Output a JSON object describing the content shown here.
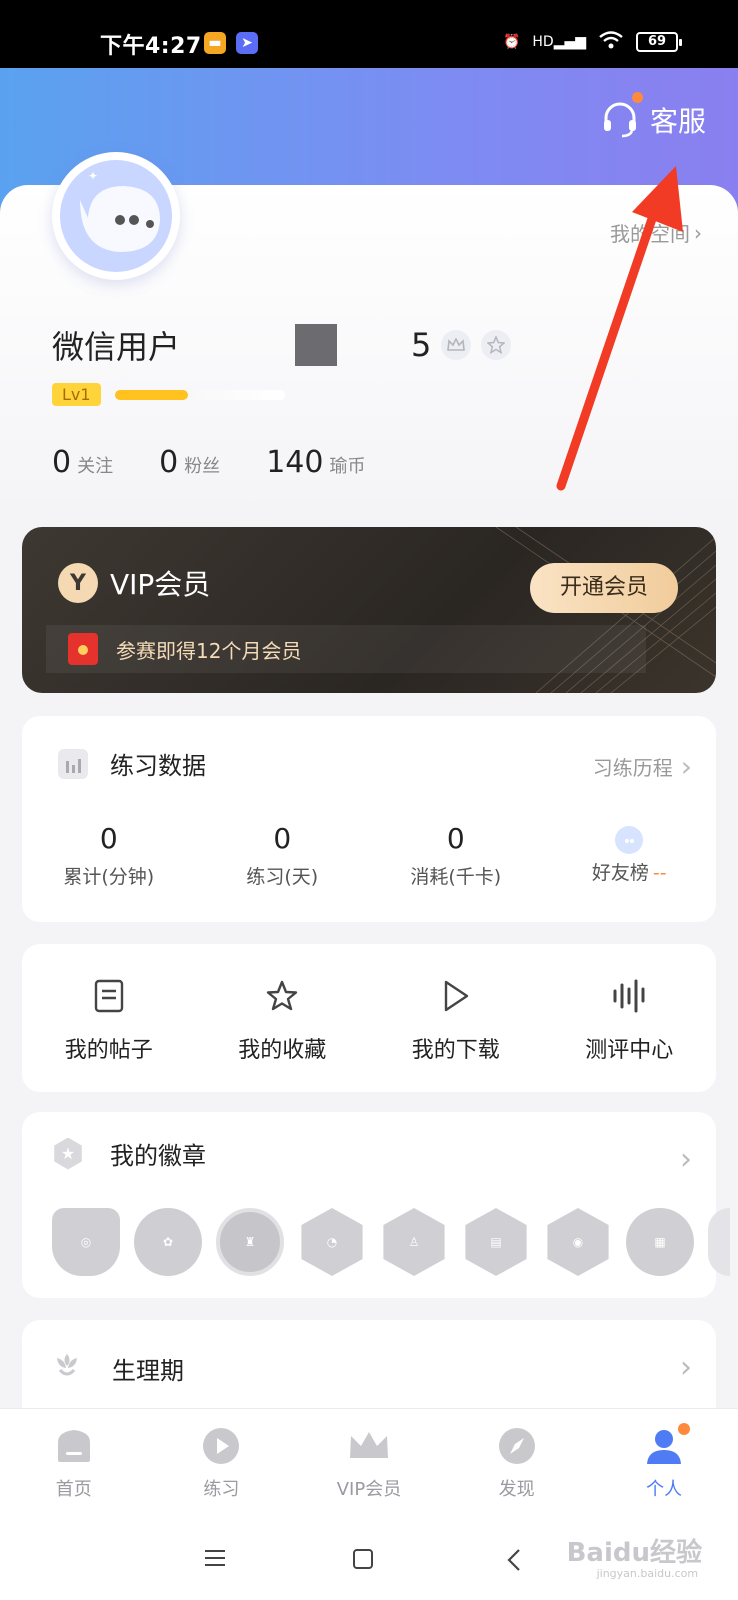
{
  "status_bar": {
    "time": "下午4:27",
    "network": "HD",
    "battery": "69"
  },
  "header": {
    "service_label": "客服"
  },
  "profile": {
    "my_space": "我的空间",
    "username_prefix": "微信用户",
    "username_suffix": "5",
    "level": "Lv1",
    "level_progress": 0.43,
    "stats": [
      {
        "value": "0",
        "label": "关注"
      },
      {
        "value": "0",
        "label": "粉丝"
      },
      {
        "value": "140",
        "label": "瑜币"
      }
    ]
  },
  "vip": {
    "title": "VIP会员",
    "button": "开通会员",
    "promo": "参赛即得12个月会员"
  },
  "practice": {
    "title": "练习数据",
    "link": "习练历程",
    "stats": [
      {
        "value": "0",
        "label": "累计(分钟)"
      },
      {
        "value": "0",
        "label": "练习(天)"
      },
      {
        "value": "0",
        "label": "消耗(千卡)"
      }
    ],
    "friends_label": "好友榜",
    "friends_value": "--"
  },
  "shortcuts": [
    {
      "label": "我的帖子",
      "icon": "document-icon"
    },
    {
      "label": "我的收藏",
      "icon": "star-icon"
    },
    {
      "label": "我的下载",
      "icon": "play-icon"
    },
    {
      "label": "测评中心",
      "icon": "waveform-icon"
    }
  ],
  "medals": {
    "title": "我的徽章"
  },
  "period": {
    "title": "生理期"
  },
  "tabbar": [
    {
      "label": "首页",
      "icon": "home-icon"
    },
    {
      "label": "练习",
      "icon": "play-circle-icon"
    },
    {
      "label": "VIP会员",
      "icon": "crown-icon"
    },
    {
      "label": "发现",
      "icon": "compass-icon"
    },
    {
      "label": "个人",
      "icon": "person-icon",
      "active": true
    }
  ],
  "watermark": {
    "text": "Baidu经验",
    "sub": "jingyan.baidu.com"
  },
  "colors": {
    "accent": "#4f7cf5",
    "header_start": "#5aa2f0",
    "header_end": "#8a7ff0",
    "vip_gold": "#f1cc9c",
    "notice_dot": "#ff8a3d",
    "arrow": "#f23b25"
  }
}
